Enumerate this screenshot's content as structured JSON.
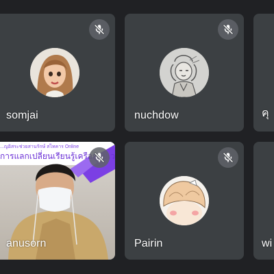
{
  "participants": [
    {
      "name": "somjai",
      "muted": true
    },
    {
      "name": "nuchdow",
      "muted": true
    },
    {
      "name": "คุ",
      "muted": false
    },
    {
      "name": "anusorn",
      "muted": true
    },
    {
      "name": "Pairin",
      "muted": true
    },
    {
      "name": "wi",
      "muted": false
    }
  ],
  "video_banner": {
    "line1": "...ญอิสระช่วยสานรักษ์ สไทคาร Online",
    "line2": "การแลกเปลี่ยนเรียนรู้เครือข่ายเว"
  },
  "colors": {
    "background": "#202124",
    "tile": "#3c4043",
    "mute_badge": "#5f6368",
    "banner_purple": "#7b3fe4"
  },
  "icons": {
    "mute": "mic-off-icon"
  }
}
